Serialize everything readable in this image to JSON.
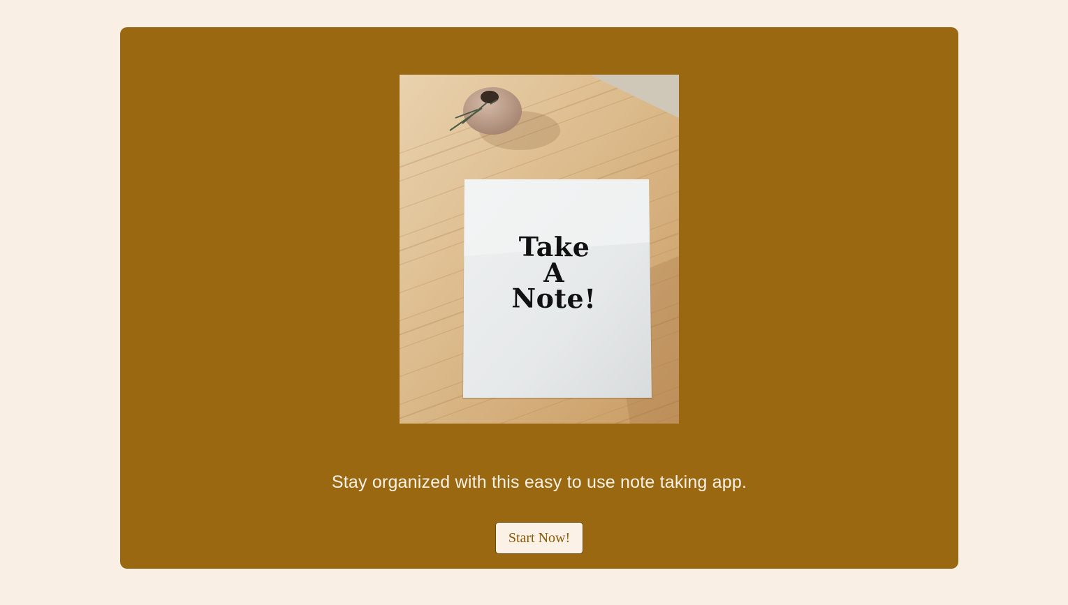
{
  "hero": {
    "paper_lines": [
      "Take",
      "A",
      "Note!"
    ]
  },
  "tagline": "Stay organized with this easy to use note taking app.",
  "cta": {
    "label": "Start Now!"
  },
  "colors": {
    "page_background": "#f9efe4",
    "card_background": "#9a6810",
    "button_background": "#fbf1e6",
    "button_text": "#8a5a06"
  }
}
